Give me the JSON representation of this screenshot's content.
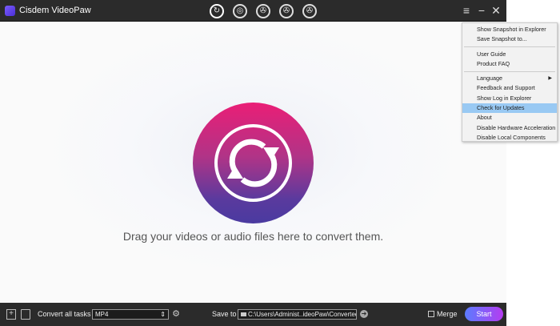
{
  "app": {
    "title": "Cisdem VideoPaw"
  },
  "modes": [
    {
      "name": "convert",
      "icon": "convert-icon",
      "active": true
    },
    {
      "name": "rip-dvd",
      "icon": "disc-icon"
    },
    {
      "name": "download",
      "icon": "film-reel-icon"
    },
    {
      "name": "edit",
      "icon": "film-reel-icon"
    },
    {
      "name": "compress",
      "icon": "film-reel-icon"
    }
  ],
  "main": {
    "drop_text": "Drag your videos or audio files here to convert them."
  },
  "bottom": {
    "convert_label": "Convert all tasks to",
    "format": "MP4",
    "save_label": "Save to",
    "save_path": "C:\\Users\\Administ..ideoPaw\\Converted",
    "merge_label": "Merge",
    "start_label": "Start"
  },
  "menu": {
    "items": [
      "Show Snapshot in Explorer",
      "Save Snapshot to...",
      "User Guide",
      "Product FAQ",
      "Language",
      "Feedback and Support",
      "Show Log in Explorer",
      "Check for Updates",
      "About",
      "Disable Hardware Acceleration",
      "Disable Local Components"
    ],
    "highlighted": "Check for Updates"
  }
}
